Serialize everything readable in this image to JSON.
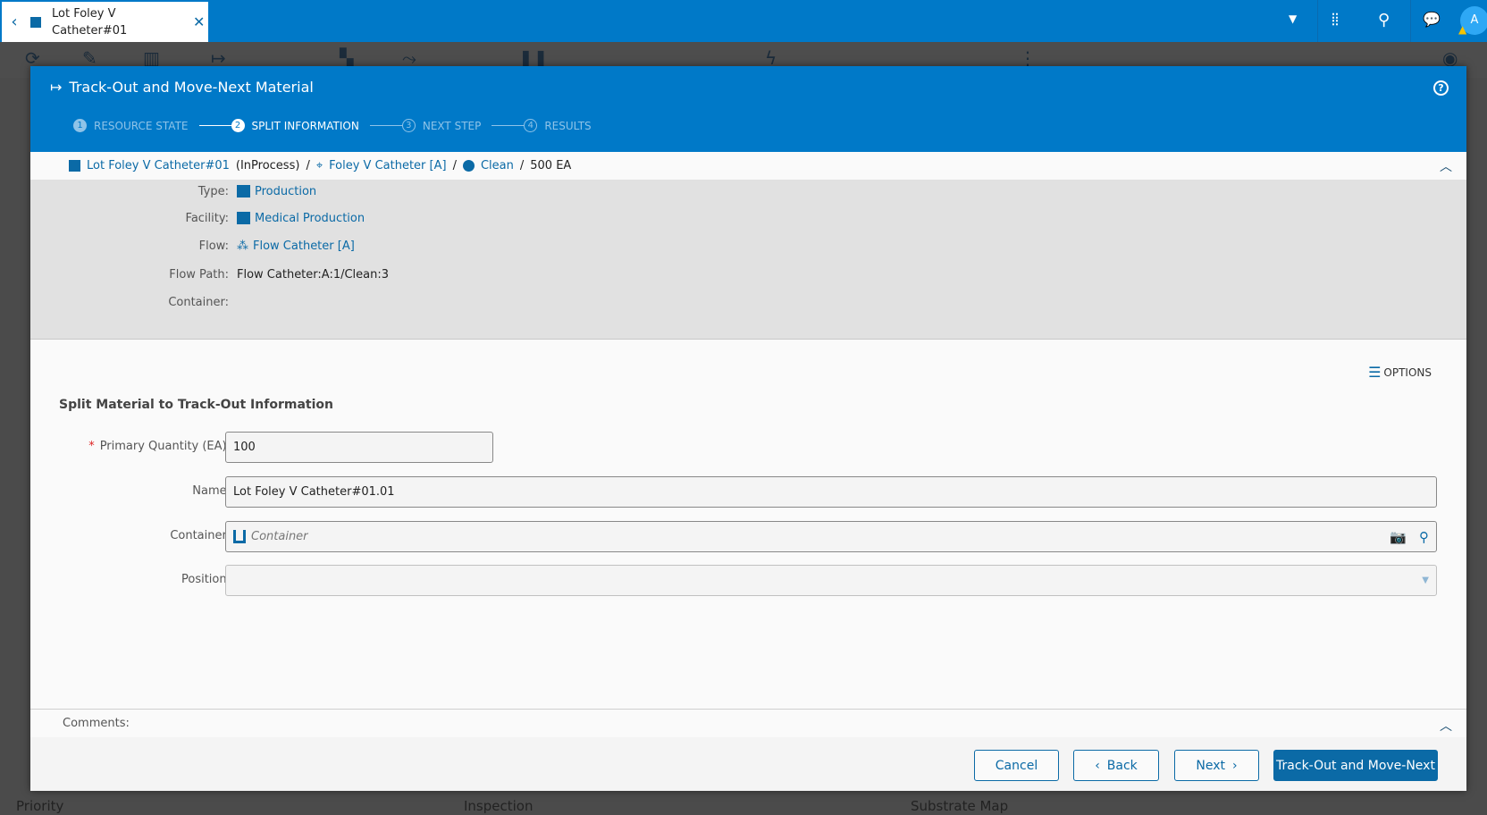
{
  "tab": {
    "title": "Lot Foley V Catheter#01"
  },
  "background": {
    "labels": [
      "Priority",
      "Inspection",
      "Substrate Map"
    ]
  },
  "dialog": {
    "title": "Track-Out and Move-Next Material",
    "steps": [
      {
        "num": "1",
        "label": "RESOURCE STATE"
      },
      {
        "num": "2",
        "label": "SPLIT INFORMATION"
      },
      {
        "num": "3",
        "label": "NEXT STEP"
      },
      {
        "num": "4",
        "label": "RESULTS"
      }
    ],
    "breadcrumb": {
      "material": "Lot Foley V Catheter#01",
      "state": "(InProcess)",
      "product": "Foley V Catheter [A]",
      "step": "Clean",
      "quantity": "500 EA",
      "sep": "/"
    },
    "details": [
      {
        "label": "Type:",
        "value": "Production"
      },
      {
        "label": "Facility:",
        "value": "Medical Production"
      },
      {
        "label": "Flow:",
        "value": "Flow Catheter [A]"
      },
      {
        "label": "Flow Path:",
        "value": "Flow Catheter:A:1/Clean:3"
      },
      {
        "label": "Container:",
        "value": ""
      }
    ],
    "options_label": "OPTIONS",
    "section_title": "Split Material to Track-Out Information",
    "form": {
      "qty_label": "Primary Quantity (EA):",
      "qty_value": "100",
      "required": "*",
      "name_label": "Name:",
      "name_value": "Lot Foley V Catheter#01.01",
      "container_label": "Container:",
      "container_placeholder": "Container",
      "position_label": "Position:"
    },
    "comments_label": "Comments:",
    "buttons": {
      "cancel": "Cancel",
      "back": "Back",
      "next": "Next",
      "submit": "Track-Out and Move-Next"
    }
  },
  "user": {
    "initial": "A"
  }
}
